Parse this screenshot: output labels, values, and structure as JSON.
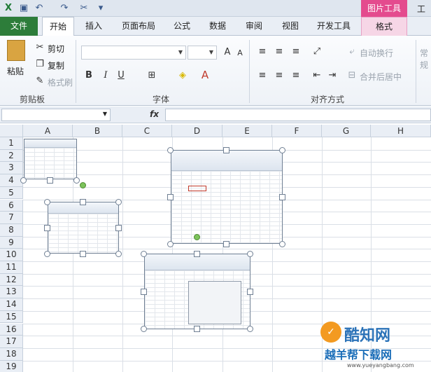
{
  "title_bar": {
    "picture_tools": "图片工具",
    "window_title": "工作"
  },
  "tabs": {
    "file": "文件",
    "home": "开始",
    "insert": "插入",
    "page_layout": "页面布局",
    "formulas": "公式",
    "data": "数据",
    "review": "审阅",
    "view": "视图",
    "developer": "开发工具",
    "format": "格式"
  },
  "ribbon": {
    "clipboard": {
      "paste": "粘贴",
      "cut": "剪切",
      "copy": "复制",
      "format_painter": "格式刷",
      "label": "剪贴板"
    },
    "font": {
      "label": "字体",
      "bold": "B",
      "italic": "I",
      "underline": "U"
    },
    "alignment": {
      "wrap_text": "自动换行",
      "merge_center": "合并后居中",
      "label": "对齐方式"
    },
    "number": {
      "format": "常规"
    }
  },
  "formula_bar": {
    "fx": "fx"
  },
  "columns": [
    "A",
    "B",
    "C",
    "D",
    "E",
    "F",
    "G",
    "H"
  ],
  "rows": [
    "1",
    "2",
    "3",
    "4",
    "5",
    "6",
    "7",
    "8",
    "9",
    "10",
    "11",
    "12",
    "13",
    "14",
    "15",
    "16",
    "17",
    "18",
    "19"
  ],
  "watermark": {
    "brand": "酷知网",
    "sub": "越羊帮下载网",
    "url": "www.yueyangbang.com"
  }
}
